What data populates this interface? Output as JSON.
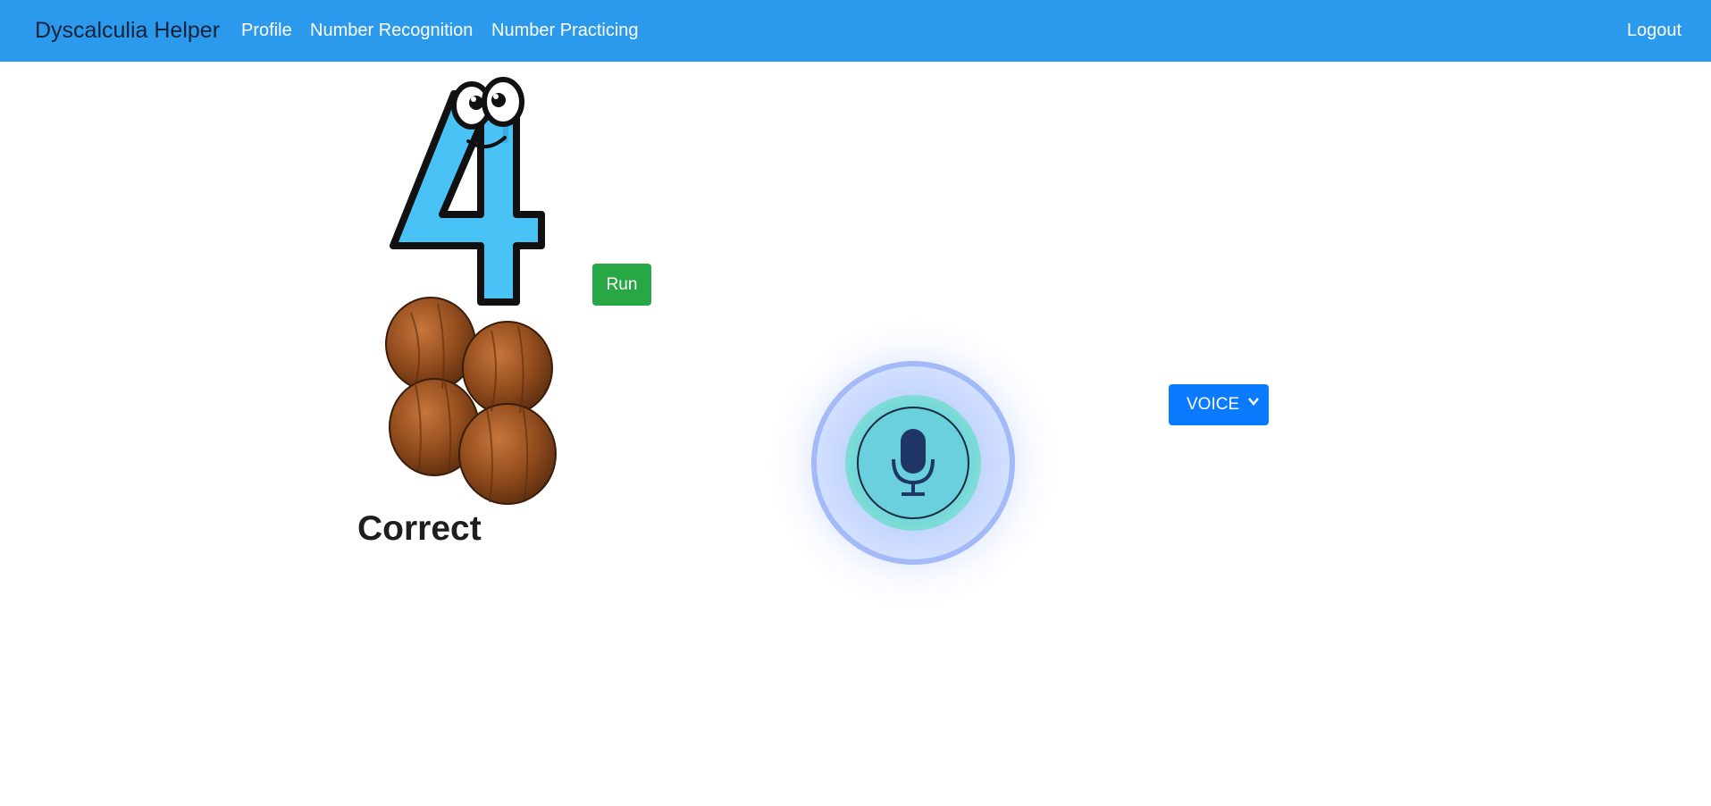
{
  "navbar": {
    "brand": "Dyscalculia Helper",
    "links": [
      "Profile",
      "Number Recognition",
      "Number Practicing"
    ],
    "logout": "Logout",
    "background": "#2b9aec"
  },
  "exercise": {
    "number_image": "number-four-cartoon",
    "count_image": "four-coconuts",
    "run_label": "Run",
    "result": "Correct"
  },
  "microphone": {
    "icon": "microphone-icon"
  },
  "mode_select": {
    "selected": "VOICE",
    "color": "#0a7bff"
  }
}
